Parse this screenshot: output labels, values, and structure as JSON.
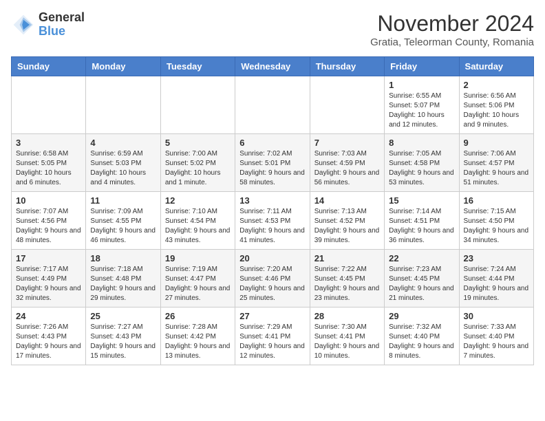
{
  "logo": {
    "general": "General",
    "blue": "Blue"
  },
  "title": "November 2024",
  "subtitle": "Gratia, Teleorman County, Romania",
  "weekdays": [
    "Sunday",
    "Monday",
    "Tuesday",
    "Wednesday",
    "Thursday",
    "Friday",
    "Saturday"
  ],
  "weeks": [
    [
      {
        "day": "",
        "info": ""
      },
      {
        "day": "",
        "info": ""
      },
      {
        "day": "",
        "info": ""
      },
      {
        "day": "",
        "info": ""
      },
      {
        "day": "",
        "info": ""
      },
      {
        "day": "1",
        "info": "Sunrise: 6:55 AM\nSunset: 5:07 PM\nDaylight: 10 hours and 12 minutes."
      },
      {
        "day": "2",
        "info": "Sunrise: 6:56 AM\nSunset: 5:06 PM\nDaylight: 10 hours and 9 minutes."
      }
    ],
    [
      {
        "day": "3",
        "info": "Sunrise: 6:58 AM\nSunset: 5:05 PM\nDaylight: 10 hours and 6 minutes."
      },
      {
        "day": "4",
        "info": "Sunrise: 6:59 AM\nSunset: 5:03 PM\nDaylight: 10 hours and 4 minutes."
      },
      {
        "day": "5",
        "info": "Sunrise: 7:00 AM\nSunset: 5:02 PM\nDaylight: 10 hours and 1 minute."
      },
      {
        "day": "6",
        "info": "Sunrise: 7:02 AM\nSunset: 5:01 PM\nDaylight: 9 hours and 58 minutes."
      },
      {
        "day": "7",
        "info": "Sunrise: 7:03 AM\nSunset: 4:59 PM\nDaylight: 9 hours and 56 minutes."
      },
      {
        "day": "8",
        "info": "Sunrise: 7:05 AM\nSunset: 4:58 PM\nDaylight: 9 hours and 53 minutes."
      },
      {
        "day": "9",
        "info": "Sunrise: 7:06 AM\nSunset: 4:57 PM\nDaylight: 9 hours and 51 minutes."
      }
    ],
    [
      {
        "day": "10",
        "info": "Sunrise: 7:07 AM\nSunset: 4:56 PM\nDaylight: 9 hours and 48 minutes."
      },
      {
        "day": "11",
        "info": "Sunrise: 7:09 AM\nSunset: 4:55 PM\nDaylight: 9 hours and 46 minutes."
      },
      {
        "day": "12",
        "info": "Sunrise: 7:10 AM\nSunset: 4:54 PM\nDaylight: 9 hours and 43 minutes."
      },
      {
        "day": "13",
        "info": "Sunrise: 7:11 AM\nSunset: 4:53 PM\nDaylight: 9 hours and 41 minutes."
      },
      {
        "day": "14",
        "info": "Sunrise: 7:13 AM\nSunset: 4:52 PM\nDaylight: 9 hours and 39 minutes."
      },
      {
        "day": "15",
        "info": "Sunrise: 7:14 AM\nSunset: 4:51 PM\nDaylight: 9 hours and 36 minutes."
      },
      {
        "day": "16",
        "info": "Sunrise: 7:15 AM\nSunset: 4:50 PM\nDaylight: 9 hours and 34 minutes."
      }
    ],
    [
      {
        "day": "17",
        "info": "Sunrise: 7:17 AM\nSunset: 4:49 PM\nDaylight: 9 hours and 32 minutes."
      },
      {
        "day": "18",
        "info": "Sunrise: 7:18 AM\nSunset: 4:48 PM\nDaylight: 9 hours and 29 minutes."
      },
      {
        "day": "19",
        "info": "Sunrise: 7:19 AM\nSunset: 4:47 PM\nDaylight: 9 hours and 27 minutes."
      },
      {
        "day": "20",
        "info": "Sunrise: 7:20 AM\nSunset: 4:46 PM\nDaylight: 9 hours and 25 minutes."
      },
      {
        "day": "21",
        "info": "Sunrise: 7:22 AM\nSunset: 4:45 PM\nDaylight: 9 hours and 23 minutes."
      },
      {
        "day": "22",
        "info": "Sunrise: 7:23 AM\nSunset: 4:45 PM\nDaylight: 9 hours and 21 minutes."
      },
      {
        "day": "23",
        "info": "Sunrise: 7:24 AM\nSunset: 4:44 PM\nDaylight: 9 hours and 19 minutes."
      }
    ],
    [
      {
        "day": "24",
        "info": "Sunrise: 7:26 AM\nSunset: 4:43 PM\nDaylight: 9 hours and 17 minutes."
      },
      {
        "day": "25",
        "info": "Sunrise: 7:27 AM\nSunset: 4:43 PM\nDaylight: 9 hours and 15 minutes."
      },
      {
        "day": "26",
        "info": "Sunrise: 7:28 AM\nSunset: 4:42 PM\nDaylight: 9 hours and 13 minutes."
      },
      {
        "day": "27",
        "info": "Sunrise: 7:29 AM\nSunset: 4:41 PM\nDaylight: 9 hours and 12 minutes."
      },
      {
        "day": "28",
        "info": "Sunrise: 7:30 AM\nSunset: 4:41 PM\nDaylight: 9 hours and 10 minutes."
      },
      {
        "day": "29",
        "info": "Sunrise: 7:32 AM\nSunset: 4:40 PM\nDaylight: 9 hours and 8 minutes."
      },
      {
        "day": "30",
        "info": "Sunrise: 7:33 AM\nSunset: 4:40 PM\nDaylight: 9 hours and 7 minutes."
      }
    ]
  ]
}
